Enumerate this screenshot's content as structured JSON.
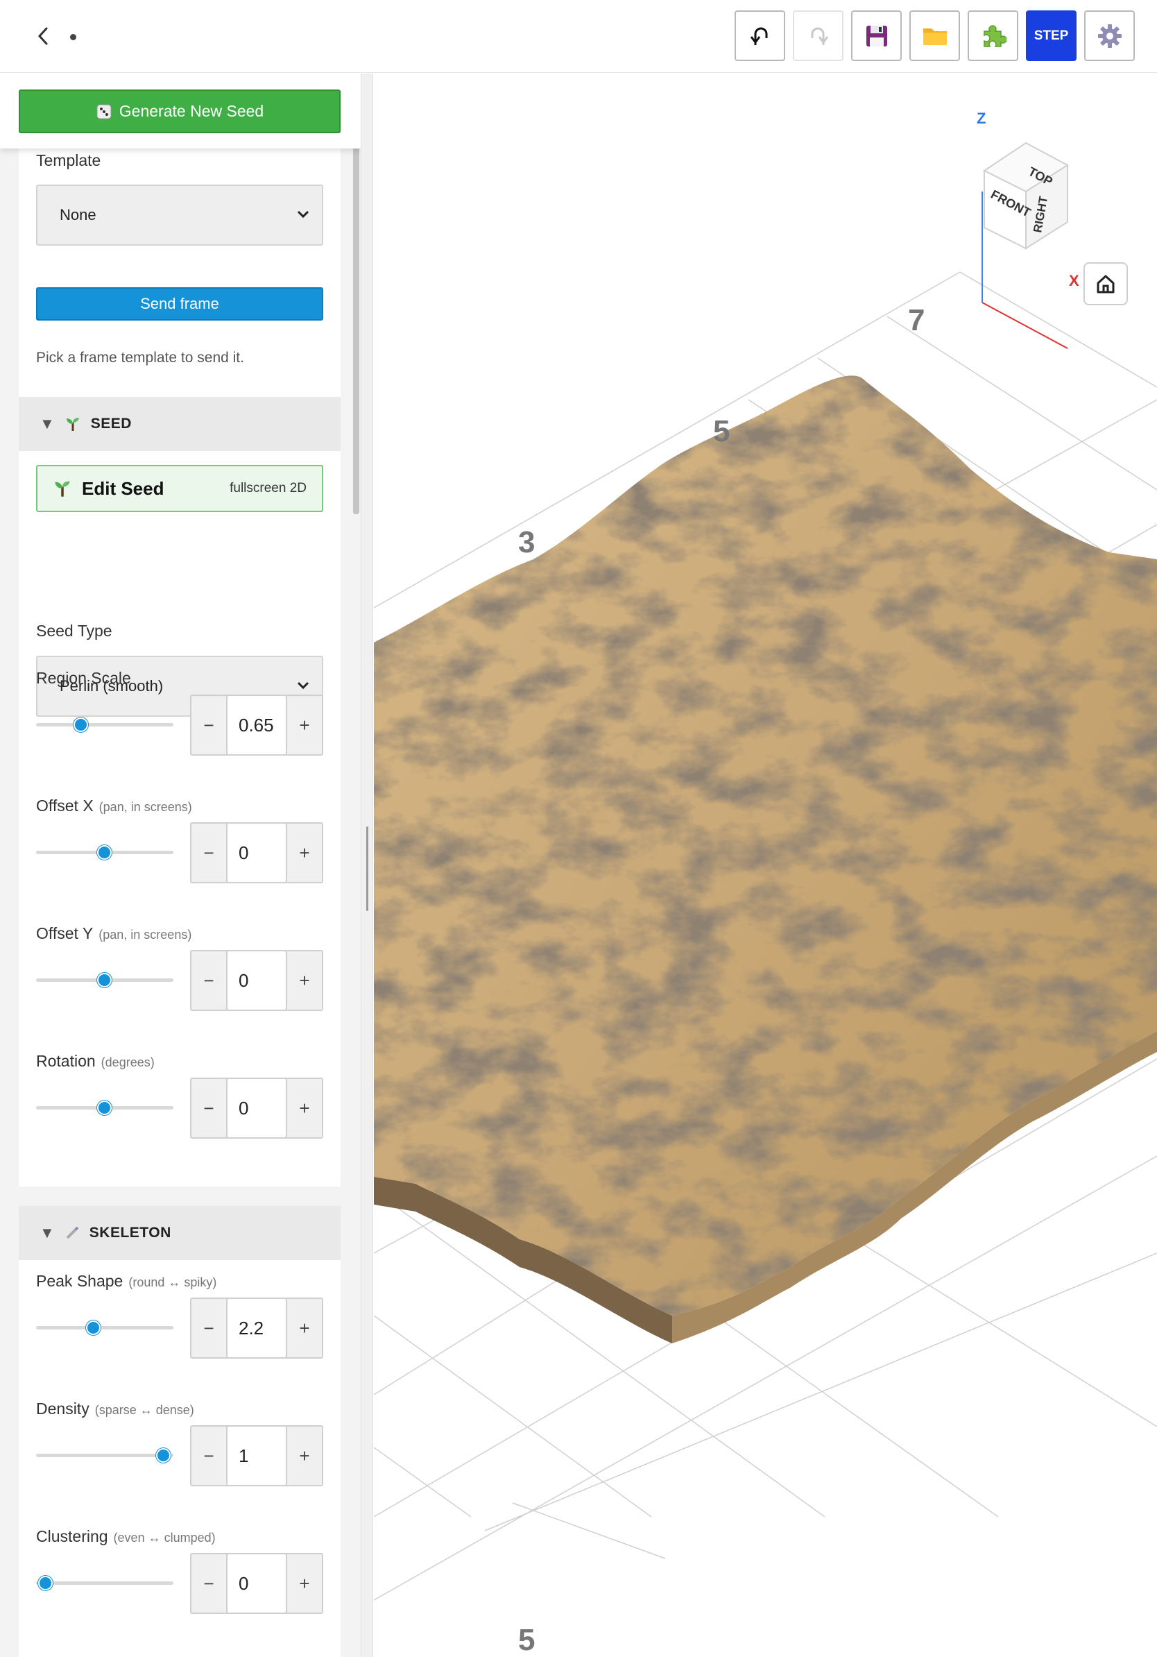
{
  "toolbar": {
    "back_icon": "chevron-left-icon",
    "buttons": [
      {
        "name": "undo",
        "icon": "undo-icon"
      },
      {
        "name": "redo",
        "icon": "redo-icon"
      },
      {
        "name": "save",
        "icon": "floppy-icon"
      },
      {
        "name": "open",
        "icon": "folder-icon"
      },
      {
        "name": "plugins",
        "icon": "puzzle-icon"
      },
      {
        "name": "step",
        "label": "STEP"
      },
      {
        "name": "settings",
        "icon": "gear-icon"
      }
    ],
    "step_label": "STEP"
  },
  "sidebar": {
    "generate_label": "Generate New Seed",
    "template": {
      "label": "Template",
      "value": "None",
      "send_label": "Send frame",
      "hint": "Pick a frame template to send it."
    },
    "seed": {
      "title": "SEED",
      "edit_label": "Edit Seed",
      "edit_sub": "fullscreen 2D",
      "seed_type_label": "Seed Type",
      "seed_type_value": "Perlin (smooth)",
      "region_scale": {
        "label": "Region Scale",
        "hint": "",
        "value": "0.65",
        "fraction": 0.33
      },
      "offset_x": {
        "label": "Offset X",
        "hint": "(pan, in screens)",
        "value": "0",
        "fraction": 0.5
      },
      "offset_y": {
        "label": "Offset Y",
        "hint": "(pan, in screens)",
        "value": "0",
        "fraction": 0.5
      },
      "rotation": {
        "label": "Rotation",
        "hint": "(degrees)",
        "value": "0",
        "fraction": 0.5
      }
    },
    "skeleton": {
      "title": "SKELETON",
      "peak_shape": {
        "label": "Peak Shape",
        "hint": "(round ↔ spiky)",
        "value": "2.2",
        "fraction": 0.42
      },
      "density": {
        "label": "Density",
        "hint": "(sparse ↔ dense)",
        "value": "1",
        "fraction": 0.93
      },
      "clustering": {
        "label": "Clustering",
        "hint": "(even ↔ clumped)",
        "value": "0",
        "fraction": 0.07
      }
    }
  },
  "viewport": {
    "grid_labels": [
      "7",
      "5",
      "3",
      "5"
    ],
    "gizmo": {
      "z": "Z",
      "x": "X",
      "top": "TOP",
      "front": "FRONT",
      "right": "RIGHT"
    },
    "home_icon": "home-icon"
  },
  "colors": {
    "accent": "#1592d8",
    "generate": "#3fae45",
    "step": "#1a3fe0",
    "terrain": "#c9a877"
  }
}
